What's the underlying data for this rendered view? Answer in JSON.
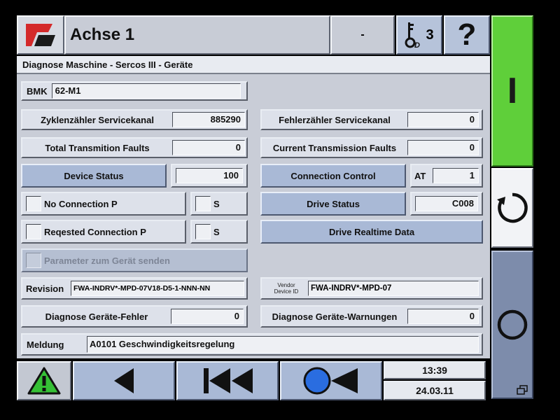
{
  "header": {
    "title": "Achse 1",
    "status": "-",
    "user_level": "3",
    "help_label": "?"
  },
  "breadcrumb": "Diagnose Maschine - Sercos III - Geräte",
  "bmk": {
    "label": "BMK",
    "value": "62-M1"
  },
  "fields": {
    "zyklen_label": "Zyklenzähler Servicekanal",
    "zyklen_value": "885290",
    "fehler_label": "Fehlerzähler Servicekanal",
    "fehler_value": "0",
    "total_label": "Total Transmition Faults",
    "total_value": "0",
    "current_label": "Current Transmission Faults",
    "current_value": "0",
    "device_status_label": "Device Status",
    "device_status_value": "100",
    "connection_control_label": "Connection Control",
    "at_label": "AT",
    "at_value": "1",
    "no_conn_label": "No Connection P",
    "no_conn_s_label": "S",
    "drive_status_label": "Drive Status",
    "drive_status_value": "C008",
    "req_conn_label": "Reqested Connection P",
    "req_conn_s_label": "S",
    "drive_realtime_label": "Drive Realtime Data",
    "param_label": "Parameter zum Gerät senden",
    "revision_label": "Revision",
    "revision_value": "FWA-INDRV*-MPD-07V18-D5-1-NNN-NN",
    "vendor_label_1": "Vendor",
    "vendor_label_2": "Device ID",
    "vendor_value": "FWA-INDRV*-MPD-07",
    "diag_fehler_label": "Diagnose Geräte-Fehler",
    "diag_fehler_value": "0",
    "diag_warn_label": "Diagnose Geräte-Warnungen",
    "diag_warn_value": "0",
    "meldung_label": "Meldung",
    "meldung_value": "A0101 Geschwindigkeitsregelung"
  },
  "footer": {
    "time": "13:39",
    "date": "24.03.11"
  },
  "side": {
    "start_label": "I"
  },
  "colors": {
    "accent_red": "#d42a2a",
    "start_green": "#5fcf3a",
    "record_blue": "#2a6de0"
  },
  "icons": [
    "logo-icon",
    "key-icon",
    "warning-icon",
    "back-icon",
    "skip-start-icon",
    "record-rewind-icon",
    "cycle-icon",
    "stop-circle-icon",
    "window-icon"
  ]
}
